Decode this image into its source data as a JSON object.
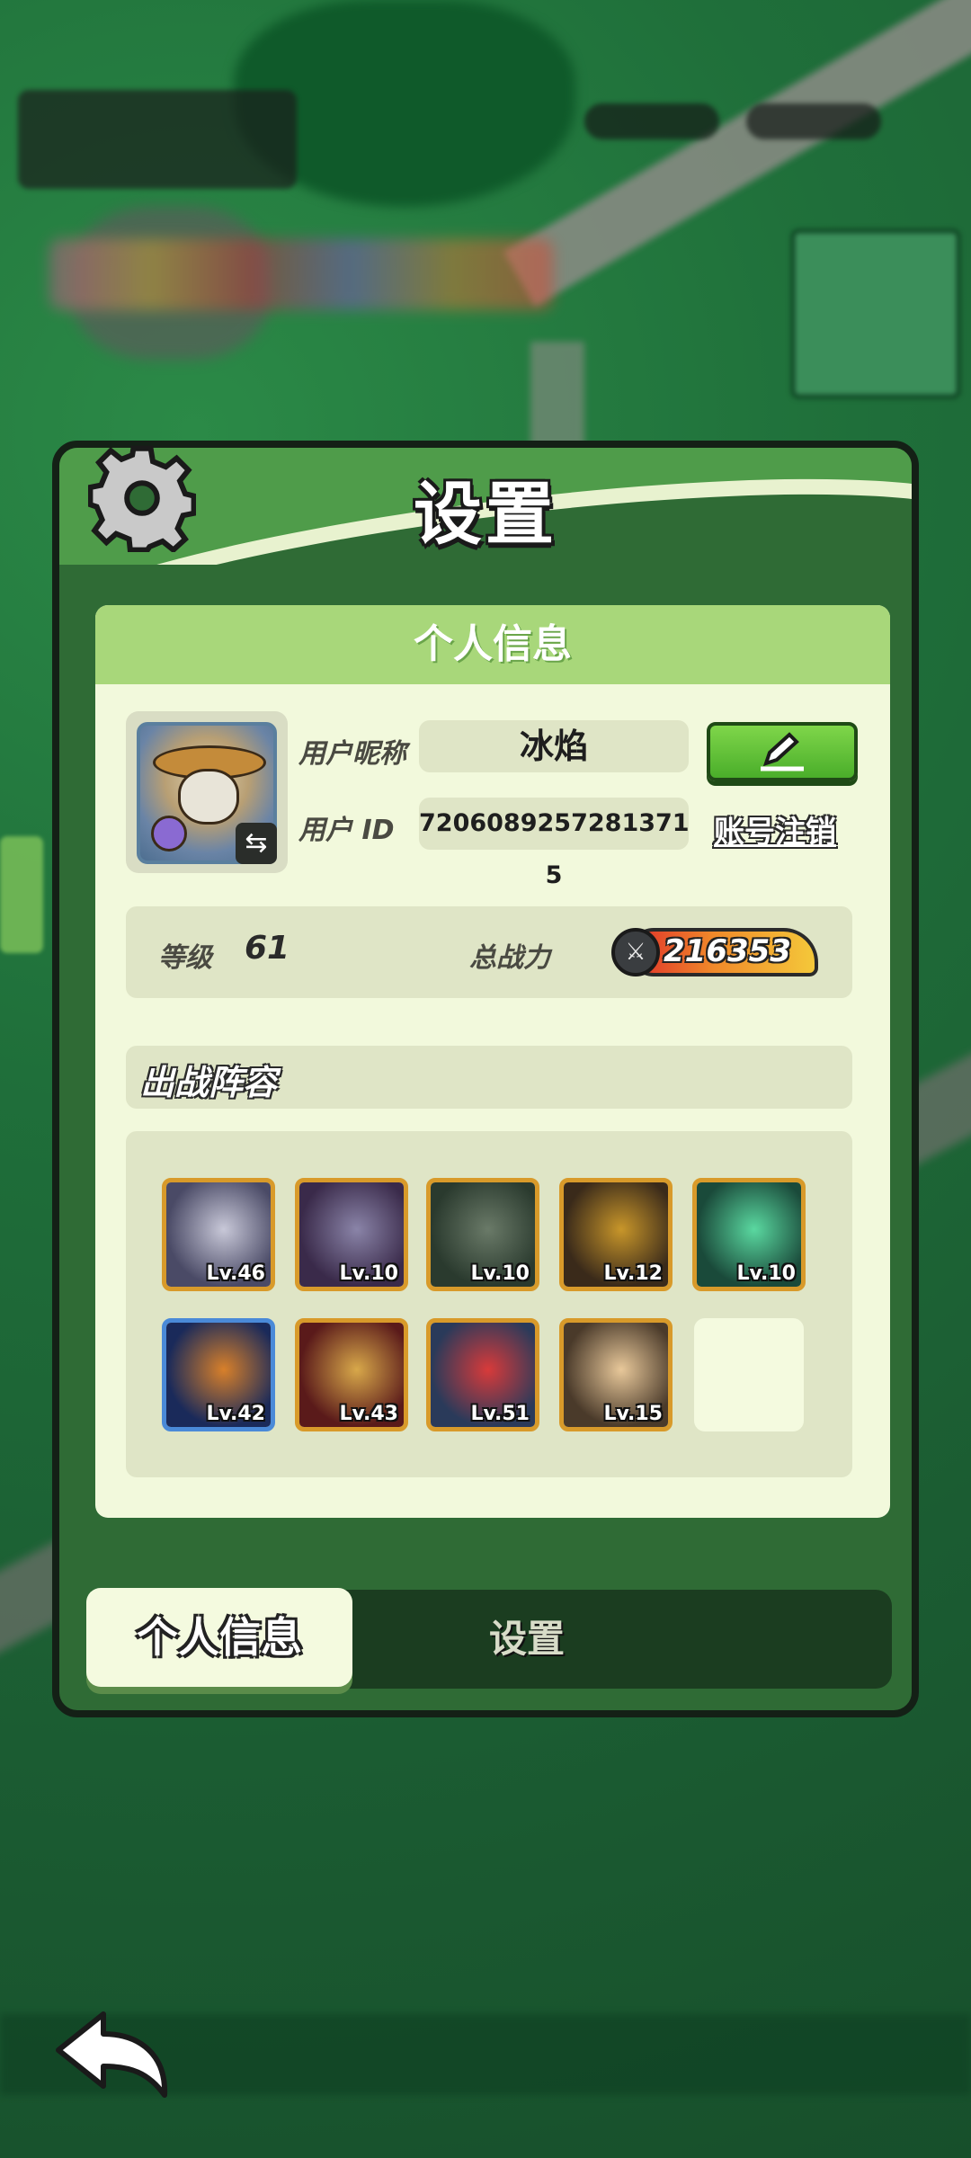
{
  "dialog": {
    "title": "设置",
    "section_title": "个人信息"
  },
  "profile": {
    "nickname_label": "用户昵称",
    "nickname": "冰焰",
    "id_label": "用户  ID",
    "user_id": "7206089257281371​5",
    "delete_account": "账号注销",
    "level_label": "等级",
    "level": "61",
    "power_label": "总战力",
    "power": "216353"
  },
  "lineup": {
    "title": "出战阵容",
    "heroes": [
      {
        "level": "Lv.46",
        "colors": [
          "#4a4a66",
          "#c8c8d8"
        ]
      },
      {
        "level": "Lv.10",
        "colors": [
          "#3a2a4a",
          "#8a84a8"
        ]
      },
      {
        "level": "Lv.10",
        "colors": [
          "#2a3a2e",
          "#6a7a68"
        ]
      },
      {
        "level": "Lv.12",
        "colors": [
          "#3a2a1a",
          "#c8962a"
        ]
      },
      {
        "level": "Lv.10",
        "colors": [
          "#1a4a3a",
          "#5ad8a0"
        ]
      },
      {
        "level": "Lv.42",
        "colors": [
          "#1a2a5a",
          "#d8802a"
        ]
      },
      {
        "level": "Lv.43",
        "colors": [
          "#5a1a1a",
          "#d8a84a"
        ]
      },
      {
        "level": "Lv.51",
        "colors": [
          "#2a3a5a",
          "#d83a3a"
        ]
      },
      {
        "level": "Lv.15",
        "colors": [
          "#4a3a2a",
          "#e8c89a"
        ]
      }
    ]
  },
  "tabs": {
    "active": "个人信息",
    "inactive": "设置"
  }
}
